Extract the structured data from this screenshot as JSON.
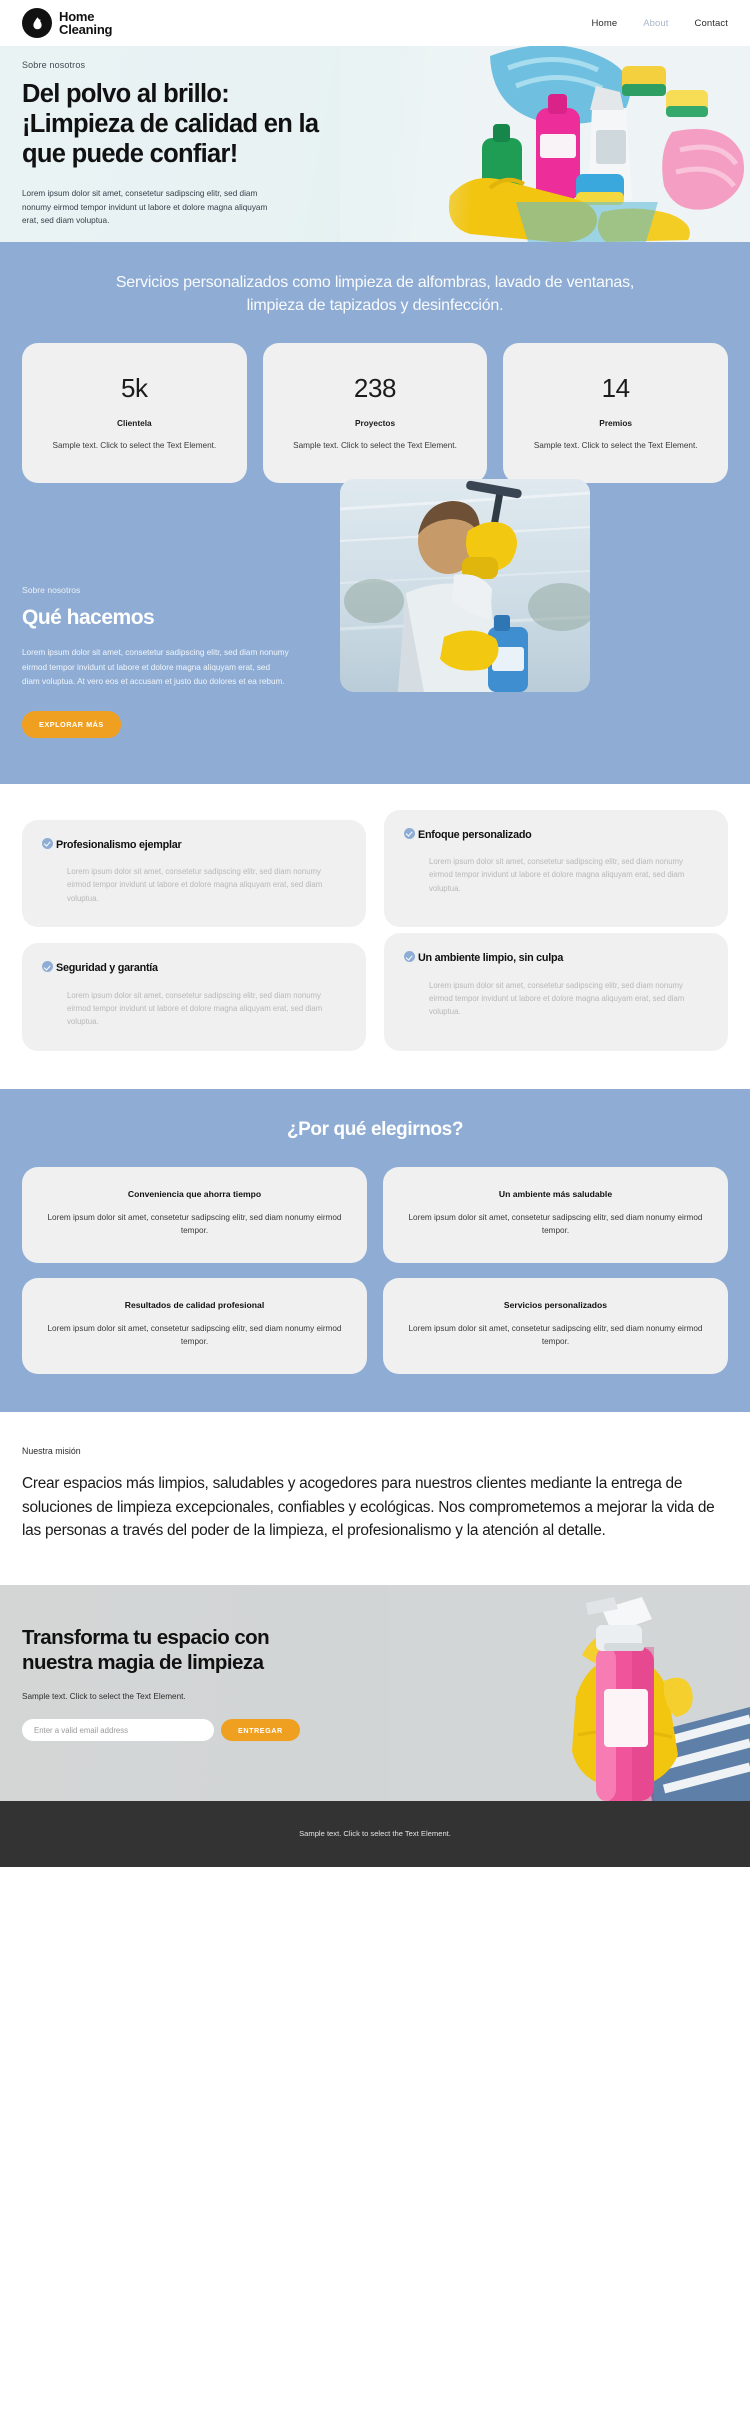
{
  "header": {
    "logo_icon": "water-droplet-icon",
    "brand_line1": "Home",
    "brand_line2": "Cleaning",
    "nav": [
      {
        "label": "Home",
        "active": false
      },
      {
        "label": "About",
        "active": true
      },
      {
        "label": "Contact",
        "active": false
      }
    ]
  },
  "hero": {
    "eyebrow": "Sobre nosotros",
    "title": "Del polvo al brillo: ¡Limpieza de calidad en la que puede confiar!",
    "copy": "Lorem ipsum dolor sit amet, consetetur sadipscing elitr, sed diam nonumy eirmod tempor invidunt ut labore et dolore magna aliquyam erat, sed diam voluptua.",
    "image_alt": "cleaning-supplies-bucket-photo"
  },
  "stats": {
    "heading": "Servicios personalizados como limpieza de alfombras, lavado de ventanas, limpieza de tapizados y desinfección.",
    "cards": [
      {
        "number": "5k",
        "label": "Clientela",
        "copy": "Sample text. Click to select the Text Element."
      },
      {
        "number": "238",
        "label": "Proyectos",
        "copy": "Sample text. Click to select the Text Element."
      },
      {
        "number": "14",
        "label": "Premios",
        "copy": "Sample text. Click to select the Text Element."
      }
    ]
  },
  "whatwedo": {
    "eyebrow": "Sobre nosotros",
    "title": "Qué hacemos",
    "copy": "Lorem ipsum dolor sit amet, consetetur sadipscing elitr, sed diam nonumy eirmod tempor invidunt ut labore et dolore magna aliquyam erat, sed diam voluptua. At vero eos et accusam et justo duo dolores et ea rebum.",
    "button": "EXPLORAR MÁS",
    "image_alt": "woman-washing-window-photo"
  },
  "features": [
    {
      "title": "Profesionalismo ejemplar",
      "copy": "Lorem ipsum dolor sit amet, consetetur sadipscing elitr, sed diam nonumy eirmod tempor invidunt ut labore et dolore magna aliquyam erat, sed diam voluptua."
    },
    {
      "title": "Enfoque personalizado",
      "copy": "Lorem ipsum dolor sit amet, consetetur sadipscing elitr, sed diam nonumy eirmod tempor invidunt ut labore et dolore magna aliquyam erat, sed diam voluptua."
    },
    {
      "title": "Seguridad y garantía",
      "copy": "Lorem ipsum dolor sit amet, consetetur sadipscing elitr, sed diam nonumy eirmod tempor invidunt ut labore et dolore magna aliquyam erat, sed diam voluptua."
    },
    {
      "title": "Un ambiente limpio, sin culpa",
      "copy": "Lorem ipsum dolor sit amet, consetetur sadipscing elitr, sed diam nonumy eirmod tempor invidunt ut labore et dolore magna aliquyam erat, sed diam voluptua."
    }
  ],
  "whyus": {
    "title": "¿Por qué elegirnos?",
    "cards": [
      {
        "title": "Conveniencia que ahorra tiempo",
        "copy": "Lorem ipsum dolor sit amet, consetetur sadipscing elitr, sed diam nonumy eirmod tempor."
      },
      {
        "title": "Un ambiente más saludable",
        "copy": "Lorem ipsum dolor sit amet, consetetur sadipscing elitr, sed diam nonumy eirmod tempor."
      },
      {
        "title": "Resultados de calidad profesional",
        "copy": "Lorem ipsum dolor sit amet, consetetur sadipscing elitr, sed diam nonumy eirmod tempor."
      },
      {
        "title": "Servicios personalizados",
        "copy": "Lorem ipsum dolor sit amet, consetetur sadipscing elitr, sed diam nonumy eirmod tempor."
      }
    ]
  },
  "mission": {
    "eyebrow": "Nuestra misión",
    "text": "Crear espacios más limpios, saludables y acogedores para nuestros clientes mediante la entrega de soluciones de limpieza excepcionales, confiables y ecológicas. Nos comprometemos a mejorar la vida de las personas a través del poder de la limpieza, el profesionalismo y la atención al detalle."
  },
  "cta": {
    "title": "Transforma tu espacio con nuestra magia de limpieza",
    "copy": "Sample text. Click to select the Text Element.",
    "email_placeholder": "Enter a valid email address",
    "email_value": "",
    "submit_label": "ENTREGAR",
    "image_alt": "gloved-hand-holding-pink-spray-bottle-photo"
  },
  "footer": {
    "text": "Sample text. Click to select the Text Element."
  },
  "colors": {
    "blue": "#8fadd4",
    "orange": "#f0a020",
    "card_gray": "#f0f0f0",
    "footer_dark": "#333333",
    "hero_bg": "#e6f1f3"
  }
}
